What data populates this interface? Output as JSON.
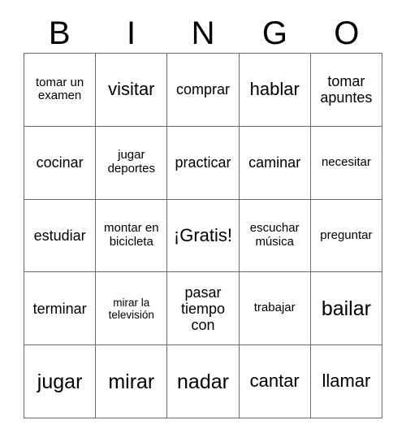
{
  "header": {
    "letters": [
      "B",
      "I",
      "N",
      "G",
      "O"
    ]
  },
  "grid": {
    "rows": [
      [
        {
          "text": "tomar un examen",
          "size": "sm"
        },
        {
          "text": "visitar",
          "size": "lg"
        },
        {
          "text": "comprar",
          "size": "md"
        },
        {
          "text": "hablar",
          "size": "lg"
        },
        {
          "text": "tomar apuntes",
          "size": "md"
        }
      ],
      [
        {
          "text": "cocinar",
          "size": "md"
        },
        {
          "text": "jugar deportes",
          "size": "sm"
        },
        {
          "text": "practicar",
          "size": "md"
        },
        {
          "text": "caminar",
          "size": "md"
        },
        {
          "text": "necesitar",
          "size": "sm"
        }
      ],
      [
        {
          "text": "estudiar",
          "size": "md"
        },
        {
          "text": "montar en bicicleta",
          "size": "sm"
        },
        {
          "text": "¡Gratis!",
          "size": "lg"
        },
        {
          "text": "escuchar música",
          "size": "sm"
        },
        {
          "text": "preguntar",
          "size": "sm"
        }
      ],
      [
        {
          "text": "terminar",
          "size": "md"
        },
        {
          "text": "mirar la televisión",
          "size": "xs"
        },
        {
          "text": "pasar tiempo con",
          "size": "md"
        },
        {
          "text": "trabajar",
          "size": "sm"
        },
        {
          "text": "bailar",
          "size": "xl"
        }
      ],
      [
        {
          "text": "jugar",
          "size": "xl"
        },
        {
          "text": "mirar",
          "size": "xl"
        },
        {
          "text": "nadar",
          "size": "xl"
        },
        {
          "text": "cantar",
          "size": "lg"
        },
        {
          "text": "llamar",
          "size": "lg"
        }
      ]
    ]
  },
  "colors": {
    "grid_line": "#6b6b6b",
    "text": "#000000",
    "background": "#ffffff"
  }
}
